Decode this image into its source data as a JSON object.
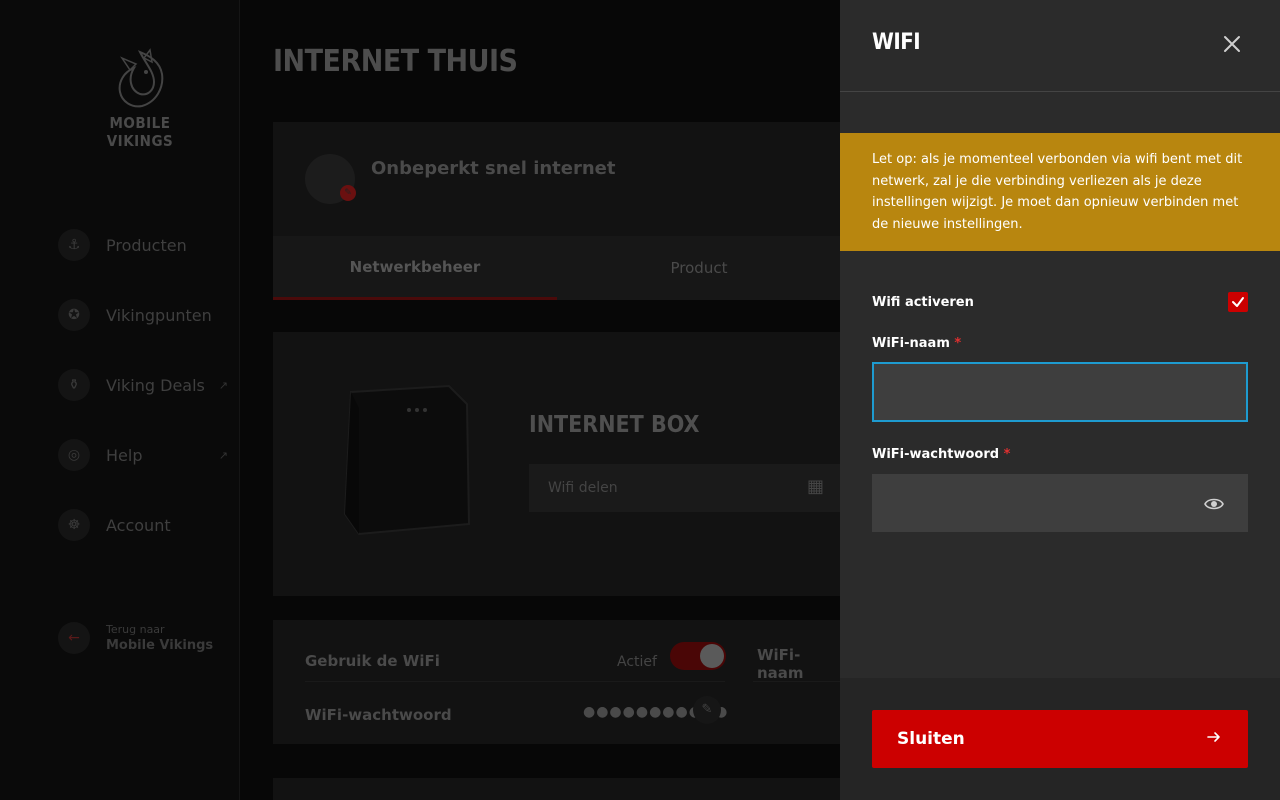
{
  "sidebar": {
    "brand": "MOBILE VIKINGS",
    "items": [
      {
        "label": "Producten",
        "icon": "anchor-icon",
        "glyph": "⚓",
        "external": false
      },
      {
        "label": "Vikingpunten",
        "icon": "treasure-icon",
        "glyph": "✪",
        "external": false
      },
      {
        "label": "Viking Deals",
        "icon": "bottle-icon",
        "glyph": "⚱",
        "external": true
      },
      {
        "label": "Help",
        "icon": "lifebuoy-icon",
        "glyph": "◎",
        "external": true
      },
      {
        "label": "Account",
        "icon": "helmet-icon",
        "glyph": "☸",
        "external": false
      }
    ],
    "back_small": "Terug naar",
    "back_big": "Mobile Vikings"
  },
  "main": {
    "title": "INTERNET THUIS",
    "subscription": "Onbeperkt snel internet",
    "tabs": [
      "Netwerkbeheer",
      "Product"
    ],
    "box_title": "INTERNET BOX",
    "share_label": "Wifi delen",
    "wifi_use_label": "Gebruik de WiFi",
    "wifi_status": "Actief",
    "wifi_name_label": "WiFi-naam",
    "wifi_password_label": "WiFi-wachtwoord",
    "wifi_password_masked": "●●●●●●●●●●●"
  },
  "drawer": {
    "title": "WIFI",
    "warning": "Let op: als je momenteel verbonden via wifi bent met dit netwerk, zal je die verbinding verliezen als je deze instellingen wijzigt. Je moet dan opnieuw verbinden met de nieuwe instellingen.",
    "activate_label": "Wifi activeren",
    "activate_checked": true,
    "name_label": "WiFi-naam",
    "name_value": "",
    "password_label": "WiFi-wachtwoord",
    "password_value": "",
    "required_mark": "*",
    "close_button": "Sluiten"
  },
  "colors": {
    "accent": "#cc0000",
    "warning": "#b8860f",
    "focus": "#1e9bd0"
  }
}
